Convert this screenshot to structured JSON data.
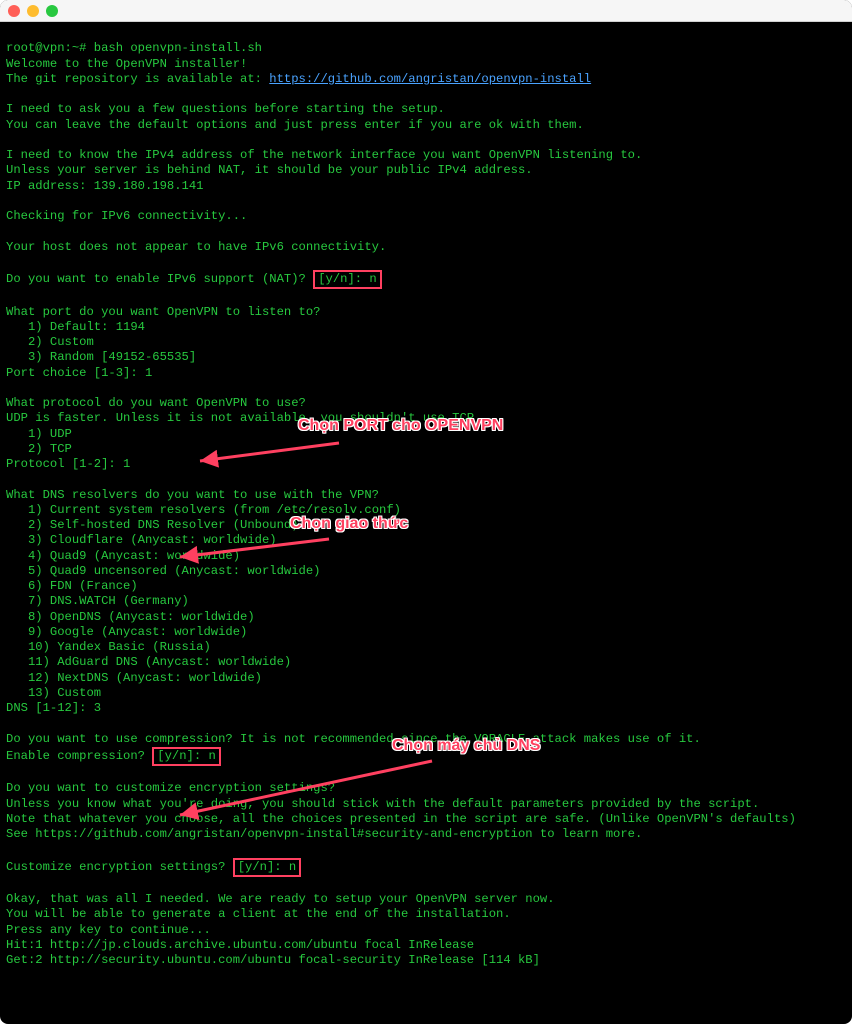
{
  "prompt_line": "root@vpn:~# bash openvpn-install.sh",
  "lines": {
    "l1": "Welcome to the OpenVPN installer!",
    "l2a": "The git repository is available at: ",
    "l2b": "https://github.com/angristan/openvpn-install",
    "l3": "I need to ask you a few questions before starting the setup.",
    "l4": "You can leave the default options and just press enter if you are ok with them.",
    "l5": "I need to know the IPv4 address of the network interface you want OpenVPN listening to.",
    "l6": "Unless your server is behind NAT, it should be your public IPv4 address.",
    "l7": "IP address: 139.180.198.141",
    "l8": "Checking for IPv6 connectivity...",
    "l9": "Your host does not appear to have IPv6 connectivity.",
    "l10a": "Do you want to enable IPv6 support (NAT)? ",
    "l10b": "[y/n]: n",
    "l11": "What port do you want OpenVPN to listen to?",
    "l12": "   1) Default: 1194",
    "l13": "   2) Custom",
    "l14": "   3) Random [49152-65535]",
    "l15": "Port choice [1-3]: 1",
    "l16": "What protocol do you want OpenVPN to use?",
    "l17": "UDP is faster. Unless it is not available, you shouldn't use TCP.",
    "l18": "   1) UDP",
    "l19": "   2) TCP",
    "l20": "Protocol [1-2]: 1",
    "l21": "What DNS resolvers do you want to use with the VPN?",
    "l22": "   1) Current system resolvers (from /etc/resolv.conf)",
    "l23": "   2) Self-hosted DNS Resolver (Unbound)",
    "l24": "   3) Cloudflare (Anycast: worldwide)",
    "l25": "   4) Quad9 (Anycast: worldwide)",
    "l26": "   5) Quad9 uncensored (Anycast: worldwide)",
    "l27": "   6) FDN (France)",
    "l28": "   7) DNS.WATCH (Germany)",
    "l29": "   8) OpenDNS (Anycast: worldwide)",
    "l30": "   9) Google (Anycast: worldwide)",
    "l31": "   10) Yandex Basic (Russia)",
    "l32": "   11) AdGuard DNS (Anycast: worldwide)",
    "l33": "   12) NextDNS (Anycast: worldwide)",
    "l34": "   13) Custom",
    "l35": "DNS [1-12]: 3",
    "l36": "Do you want to use compression? It is not recommended since the VORACLE attack makes use of it.",
    "l37a": "Enable compression? ",
    "l37b": "[y/n]: n",
    "l38": "Do you want to customize encryption settings?",
    "l39": "Unless you know what you're doing, you should stick with the default parameters provided by the script.",
    "l40": "Note that whatever you choose, all the choices presented in the script are safe. (Unlike OpenVPN's defaults)",
    "l41": "See https://github.com/angristan/openvpn-install#security-and-encryption to learn more.",
    "l42a": "Customize encryption settings? ",
    "l42b": "[y/n]: n",
    "l43": "Okay, that was all I needed. We are ready to setup your OpenVPN server now.",
    "l44": "You will be able to generate a client at the end of the installation.",
    "l45": "Press any key to continue...",
    "l46": "Hit:1 http://jp.clouds.archive.ubuntu.com/ubuntu focal InRelease",
    "l47": "Get:2 http://security.ubuntu.com/ubuntu focal-security InRelease [114 kB]"
  },
  "annotations": {
    "a1": "Chọn PORT cho OPENVPN",
    "a2": "Chọn giao thức",
    "a3": "Chọn máy chủ DNS"
  }
}
